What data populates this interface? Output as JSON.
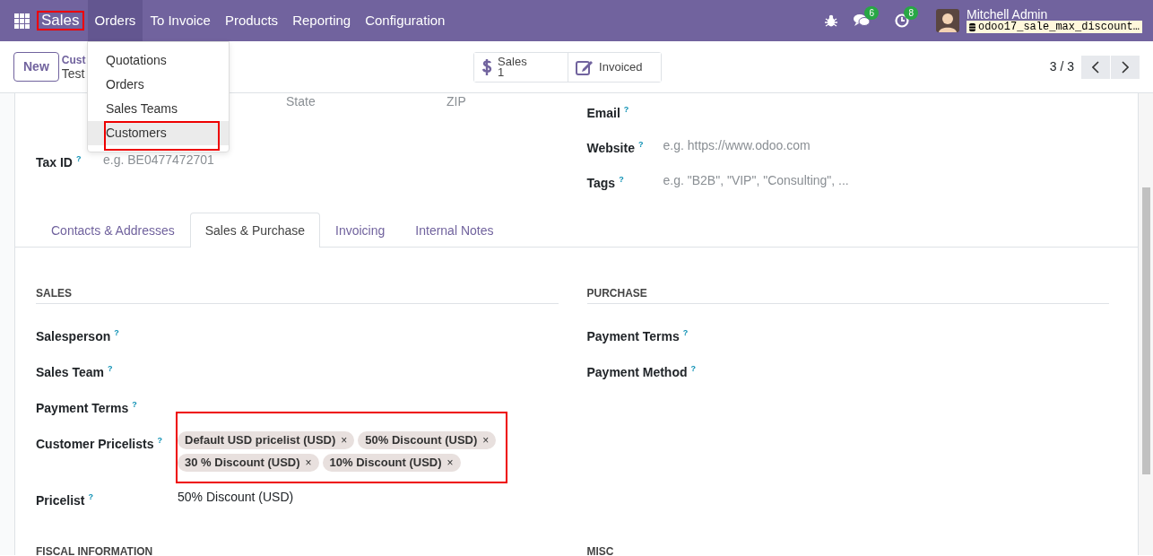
{
  "navbar": {
    "app": "Sales",
    "app_highlighted": true,
    "menus": [
      {
        "label": "Orders",
        "expanded": true
      },
      {
        "label": "To Invoice",
        "expanded": false
      },
      {
        "label": "Products",
        "expanded": false
      },
      {
        "label": "Reporting",
        "expanded": false
      },
      {
        "label": "Configuration",
        "expanded": false
      }
    ],
    "chat_count": "6",
    "activity_count": "8",
    "user": "Mitchell Admin",
    "database": "odoo17_sale_max_discount…"
  },
  "dropdown": {
    "items": [
      {
        "label": "Quotations",
        "selected": false,
        "highlighted": false
      },
      {
        "label": "Orders",
        "selected": false,
        "highlighted": false
      },
      {
        "label": "Sales Teams",
        "selected": false,
        "highlighted": false
      },
      {
        "label": "Customers",
        "selected": true,
        "highlighted": true
      }
    ]
  },
  "control_panel": {
    "new_button": "New",
    "breadcrumb": [
      "Cust",
      "Test"
    ],
    "smart_buttons": [
      {
        "kind": "sales",
        "label": "Sales",
        "value": "1"
      },
      {
        "kind": "invoiced",
        "label": "Invoiced"
      }
    ],
    "pager": "3 / 3"
  },
  "form": {
    "address": {
      "state_placeholder": "State",
      "zip_placeholder": "ZIP"
    },
    "tax_id": {
      "label": "Tax ID",
      "help": "?",
      "placeholder": "e.g. BE0477472701"
    },
    "right_fields": [
      {
        "label": "Email",
        "help": "?"
      },
      {
        "label": "Website",
        "help": "?",
        "placeholder": "e.g. https://www.odoo.com"
      },
      {
        "label": "Tags",
        "help": "?",
        "placeholder": "e.g. \"B2B\", \"VIP\", \"Consulting\", ..."
      }
    ]
  },
  "tabs": [
    {
      "label": "Contacts & Addresses",
      "selected": false
    },
    {
      "label": "Sales & Purchase",
      "selected": true
    },
    {
      "label": "Invoicing",
      "selected": false
    },
    {
      "label": "Internal Notes",
      "selected": false
    }
  ],
  "sales": {
    "title": "SALES",
    "fields": [
      {
        "label": "Salesperson",
        "help": "?"
      },
      {
        "label": "Sales Team",
        "help": "?"
      },
      {
        "label": "Payment Terms",
        "help": "?"
      },
      {
        "kind": "tags",
        "label": "Customer Pricelists",
        "help": "?",
        "highlighted": true,
        "tags": [
          {
            "label": "Default USD pricelist (USD)",
            "remove": "×"
          },
          {
            "label": "50% Discount (USD)",
            "remove": "×"
          },
          {
            "label": "30 % Discount (USD)",
            "remove": "×"
          },
          {
            "label": "10% Discount (USD)",
            "remove": "×"
          }
        ]
      },
      {
        "kind": "text",
        "label": "Pricelist",
        "help": "?",
        "value": "50% Discount (USD)"
      }
    ]
  },
  "purchase": {
    "title": "PURCHASE",
    "fields": [
      {
        "label": "Payment Terms",
        "help": "?"
      },
      {
        "label": "Payment Method",
        "help": "?"
      }
    ]
  },
  "more_sections": [
    "FISCAL INFORMATION",
    "MISC"
  ]
}
